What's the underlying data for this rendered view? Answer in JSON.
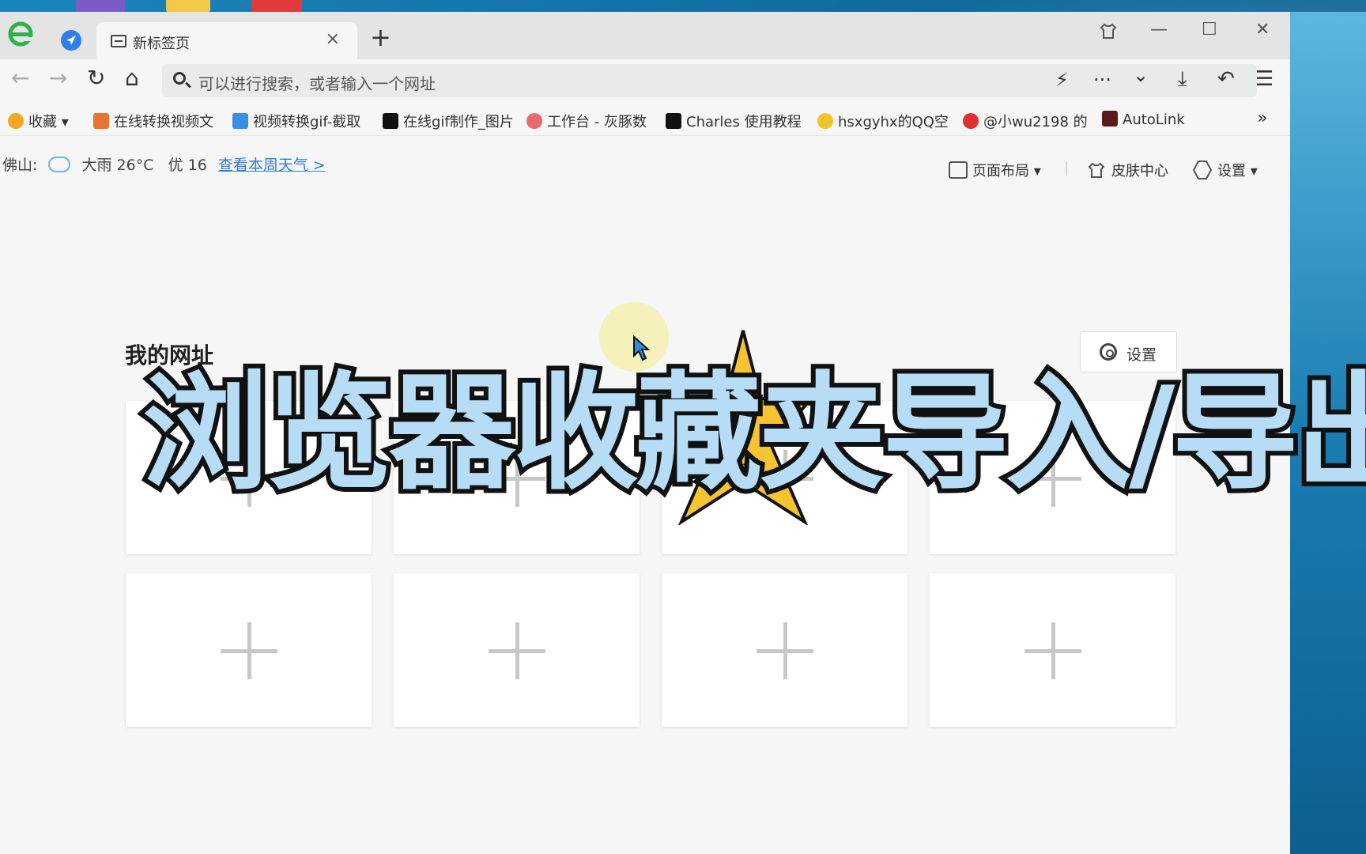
{
  "tab": {
    "title": "新标签页",
    "close": "×",
    "new_tab": "+"
  },
  "window": {
    "skin": "⌂",
    "minimize": "—",
    "maximize": "☐",
    "close": "✕"
  },
  "nav": {
    "back": "←",
    "forward": "→",
    "refresh": "↻",
    "home": "⌂",
    "placeholder": "可以进行搜索，或者输入一个网址",
    "lightning": "⚡",
    "more": "···",
    "dropdown": "⌄",
    "download": "⤓",
    "undo": "↶",
    "menu": "☰"
  },
  "bookmarks": [
    {
      "label": "收藏",
      "color": "#f5a623"
    },
    {
      "label": "在线转换视频文",
      "color": "#e8742f"
    },
    {
      "label": "视频转换gif-截取",
      "color": "#3a8ee6"
    },
    {
      "label": "在线gif制作_图片",
      "color": "#111111"
    },
    {
      "label": "工作台 - 灰豚数",
      "color": "#e86a6a"
    },
    {
      "label": "Charles 使用教程",
      "color": "#111111"
    },
    {
      "label": "hsxgyhx的QQ空",
      "color": "#f2c12e"
    },
    {
      "label": "@小wu2198 的",
      "color": "#e03030"
    },
    {
      "label": "AutoLink",
      "color": "#5a1a1a"
    }
  ],
  "bookmarks_more": "»",
  "weather": {
    "city": "佛山:",
    "condition": "大雨 26°C",
    "aqi": "优 16",
    "link": "查看本周天气 >"
  },
  "toolbar": {
    "layout": "页面布局 ▾",
    "skin_center": "皮肤中心",
    "settings": "设置 ▾"
  },
  "section": {
    "title": "我的网址",
    "settings_button": "设置"
  },
  "overlay": {
    "title": "浏览器收藏夹导入/导出"
  }
}
